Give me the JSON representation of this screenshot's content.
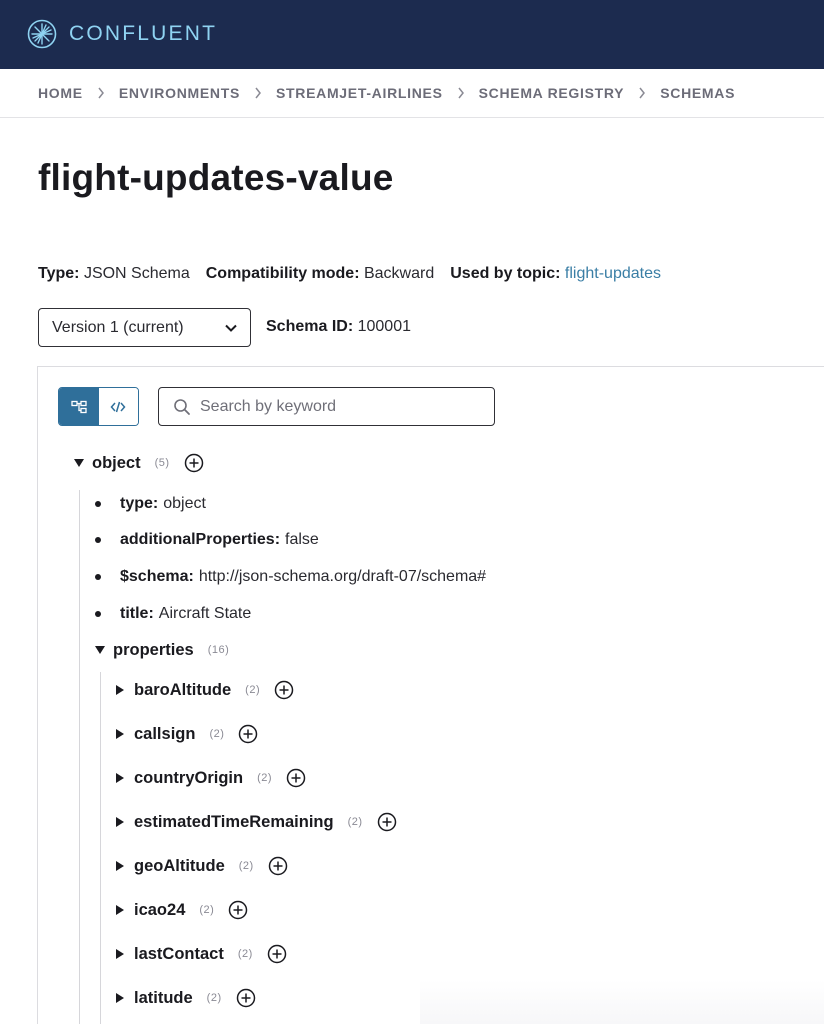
{
  "brand": {
    "name": "CONFLUENT"
  },
  "breadcrumb": [
    "HOME",
    "ENVIRONMENTS",
    "STREAMJET-AIRLINES",
    "SCHEMA REGISTRY",
    "SCHEMAS"
  ],
  "page": {
    "title": "flight-updates-value"
  },
  "meta": {
    "type_label": "Type:",
    "type_value": "JSON Schema",
    "compat_label": "Compatibility mode:",
    "compat_value": "Backward",
    "topic_label": "Used by topic:",
    "topic_value": "flight-updates"
  },
  "version": {
    "selected": "Version 1 (current)"
  },
  "schema_id": {
    "label": "Schema ID:",
    "value": "100001"
  },
  "search": {
    "placeholder": "Search by keyword"
  },
  "tree": {
    "root": {
      "name": "object",
      "count": "(5)"
    },
    "fields": [
      {
        "key": "type:",
        "value": "object"
      },
      {
        "key": "additionalProperties:",
        "value": "false"
      },
      {
        "key": "$schema:",
        "value": "http://json-schema.org/draft-07/schema#"
      },
      {
        "key": "title:",
        "value": "Aircraft State"
      }
    ],
    "properties": {
      "name": "properties",
      "count": "(16)"
    },
    "children": [
      {
        "name": "baroAltitude",
        "count": "(2)"
      },
      {
        "name": "callsign",
        "count": "(2)"
      },
      {
        "name": "countryOrigin",
        "count": "(2)"
      },
      {
        "name": "estimatedTimeRemaining",
        "count": "(2)"
      },
      {
        "name": "geoAltitude",
        "count": "(2)"
      },
      {
        "name": "icao24",
        "count": "(2)"
      },
      {
        "name": "lastContact",
        "count": "(2)"
      },
      {
        "name": "latitude",
        "count": "(2)"
      }
    ]
  },
  "colors": {
    "header_bg": "#1c2b4f",
    "brand_text": "#8fd3f2",
    "accent": "#2f6f9a",
    "link": "#3a7ea5"
  },
  "icons": [
    "confluent-logo-icon",
    "chevron-right-icon",
    "chevron-down-icon",
    "tree-view-icon",
    "code-view-icon",
    "search-icon",
    "add-circle-icon"
  ]
}
